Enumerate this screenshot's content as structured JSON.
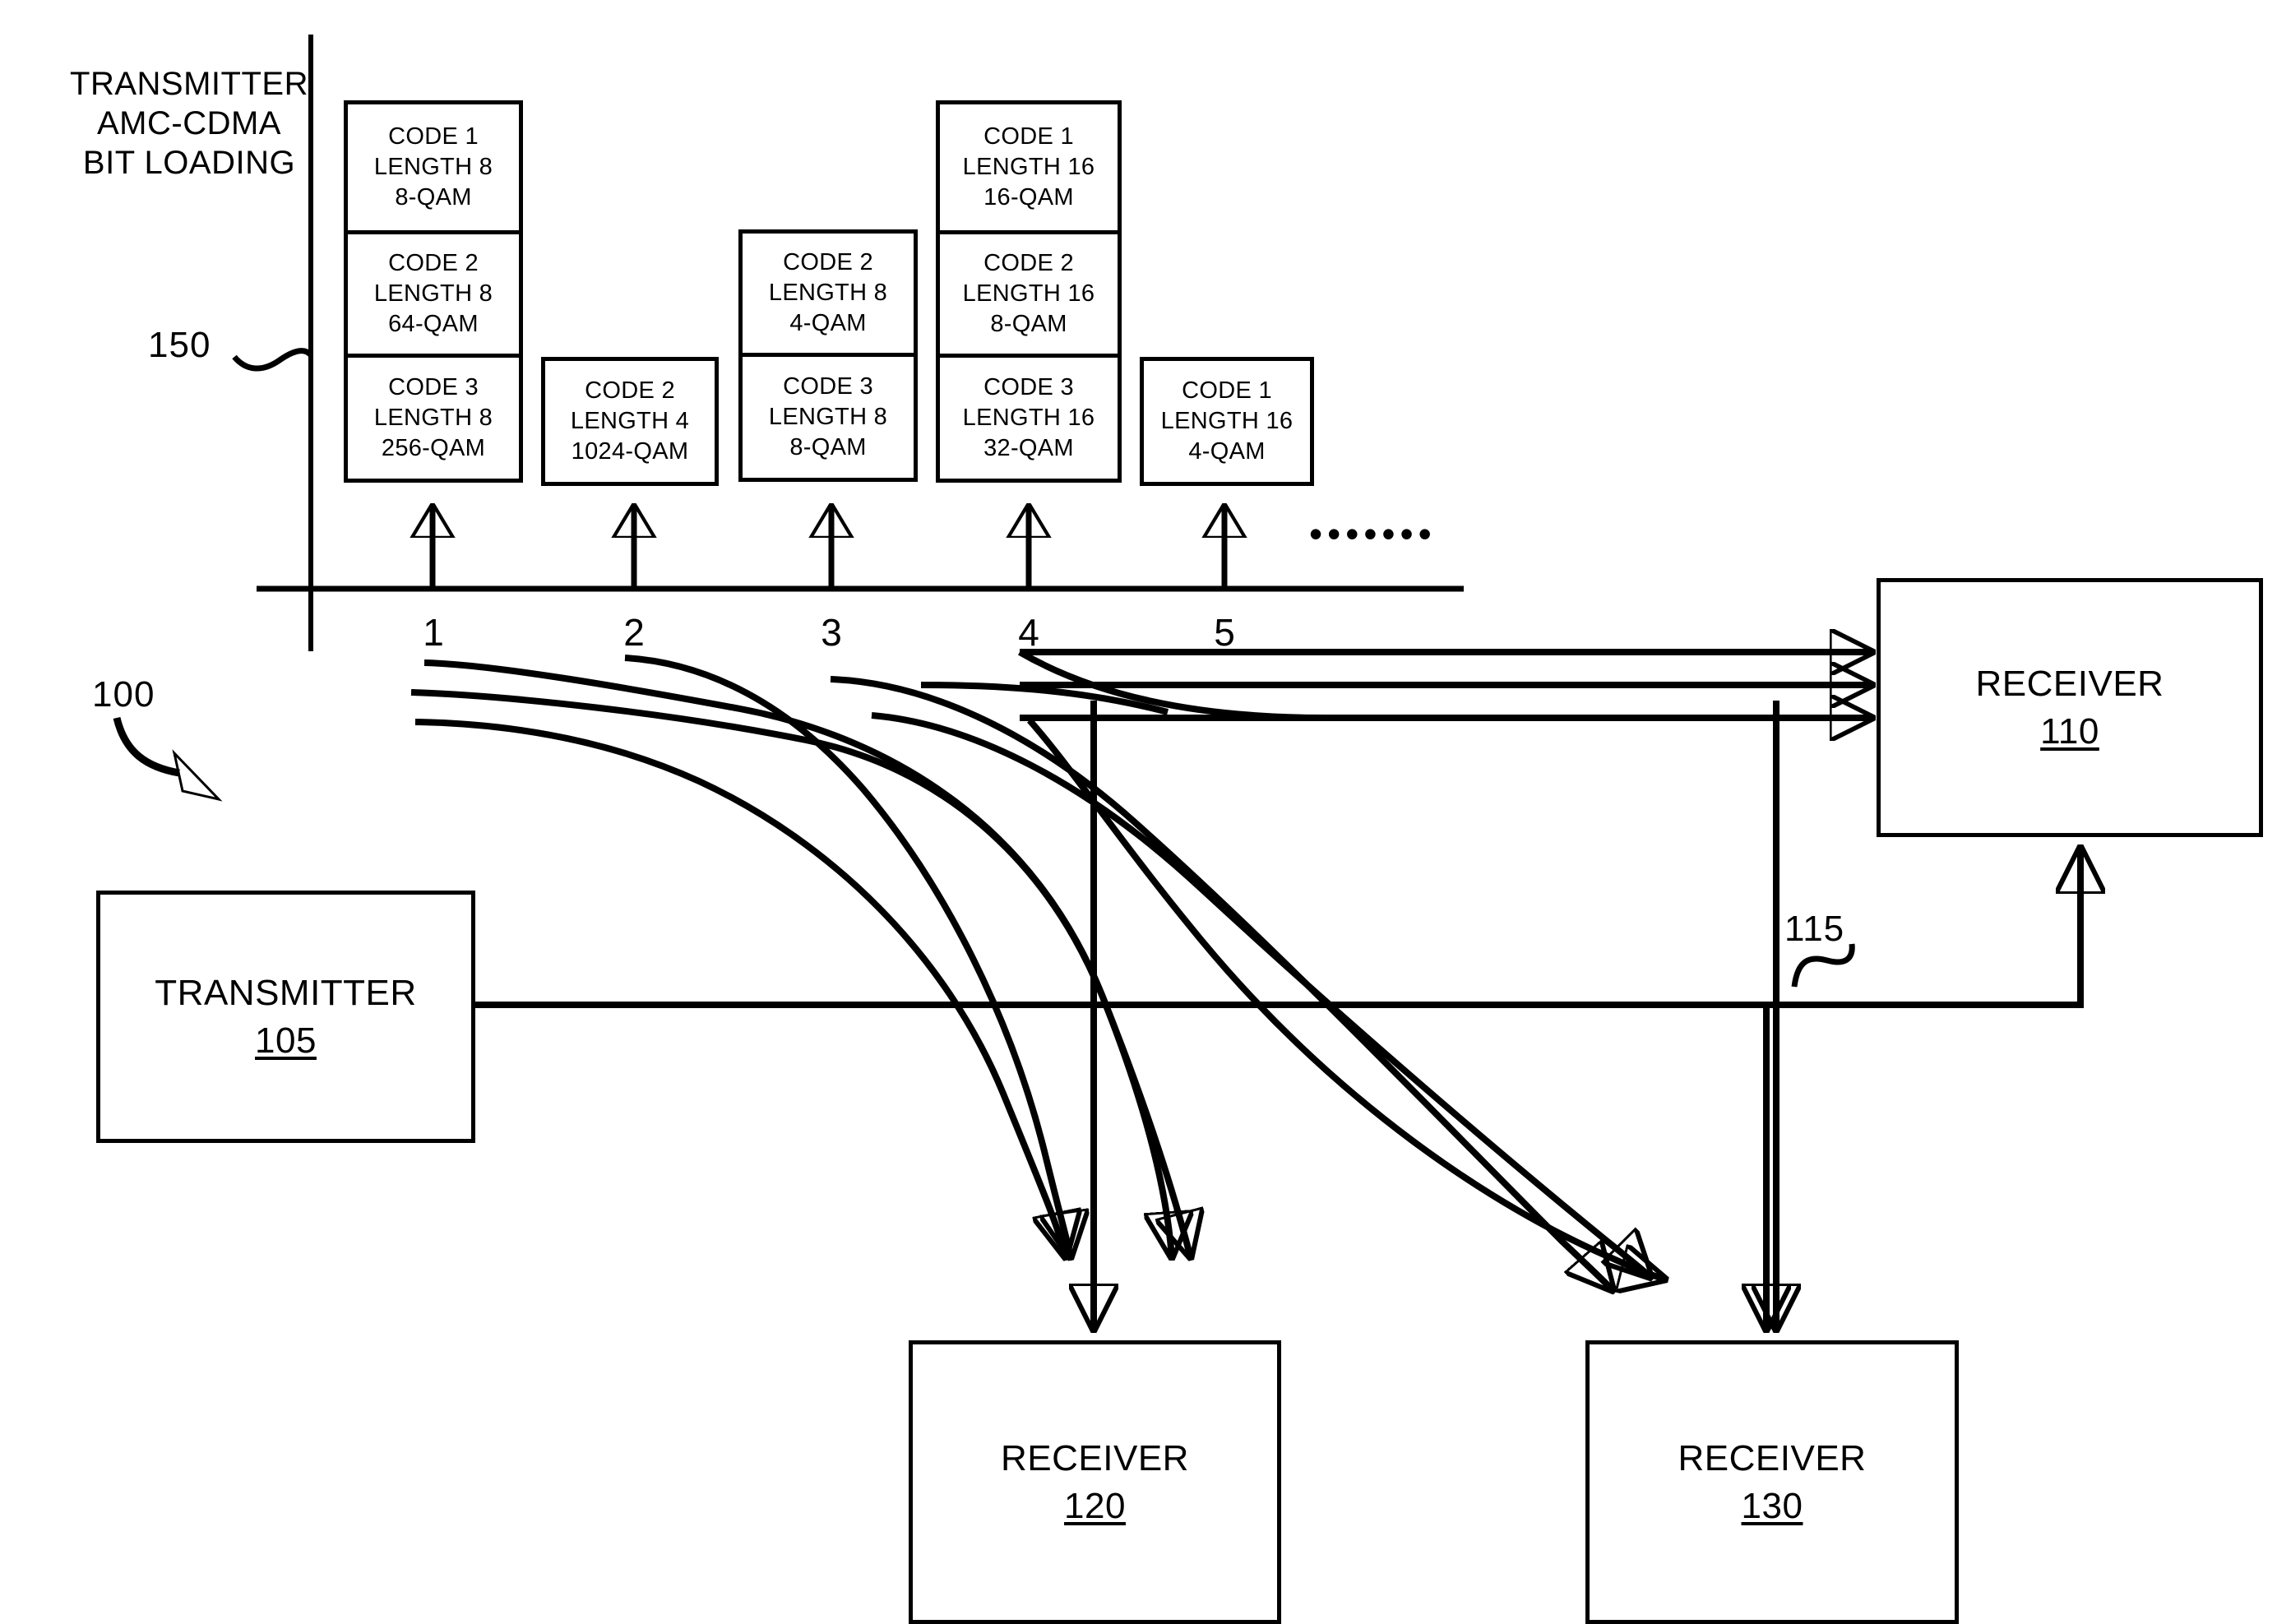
{
  "figure": {
    "axis_title": "TRANSMITTER\nAMC-CDMA\nBIT LOADING",
    "ref_150": "150",
    "ref_100": "100",
    "ref_115": "115",
    "ellipsis": "•••••••",
    "accent_color": "#000000",
    "background_color": "#ffffff"
  },
  "axis": {
    "tick_labels": [
      "1",
      "2",
      "3",
      "4",
      "5"
    ]
  },
  "chart_data": {
    "type": "bar",
    "title": "TRANSMITTER AMC-CDMA BIT LOADING",
    "xlabel": "",
    "ylabel": "",
    "grid": false,
    "legend": "none",
    "categories": [
      "1",
      "2",
      "3",
      "4",
      "5"
    ],
    "values": [
      3,
      1,
      2,
      3,
      1
    ],
    "note": "Stacked code-allocation bars; value = number of codes stacked on each carrier",
    "columns": [
      {
        "carrier": "1",
        "codes": [
          {
            "code": "CODE 1",
            "length": "LENGTH 8",
            "qam": "8-QAM"
          },
          {
            "code": "CODE 2",
            "length": "LENGTH 8",
            "qam": "64-QAM"
          },
          {
            "code": "CODE 3",
            "length": "LENGTH 8",
            "qam": "256-QAM"
          }
        ]
      },
      {
        "carrier": "2",
        "codes": [
          {
            "code": "CODE 2",
            "length": "LENGTH 4",
            "qam": "1024-QAM"
          }
        ]
      },
      {
        "carrier": "3",
        "codes": [
          {
            "code": "CODE 2",
            "length": "LENGTH 8",
            "qam": "4-QAM"
          },
          {
            "code": "CODE 3",
            "length": "LENGTH 8",
            "qam": "8-QAM"
          }
        ]
      },
      {
        "carrier": "4",
        "codes": [
          {
            "code": "CODE 1",
            "length": "LENGTH 16",
            "qam": "16-QAM"
          },
          {
            "code": "CODE 2",
            "length": "LENGTH 16",
            "qam": "8-QAM"
          },
          {
            "code": "CODE 3",
            "length": "LENGTH 16",
            "qam": "32-QAM"
          }
        ]
      },
      {
        "carrier": "5",
        "codes": [
          {
            "code": "CODE 1",
            "length": "LENGTH 16",
            "qam": "4-QAM"
          }
        ]
      }
    ]
  },
  "blocks": {
    "transmitter": {
      "label": "TRANSMITTER",
      "number": "105"
    },
    "receiver_110": {
      "label": "RECEIVER",
      "number": "110"
    },
    "receiver_120": {
      "label": "RECEIVER",
      "number": "120"
    },
    "receiver_130": {
      "label": "RECEIVER",
      "number": "130"
    }
  }
}
